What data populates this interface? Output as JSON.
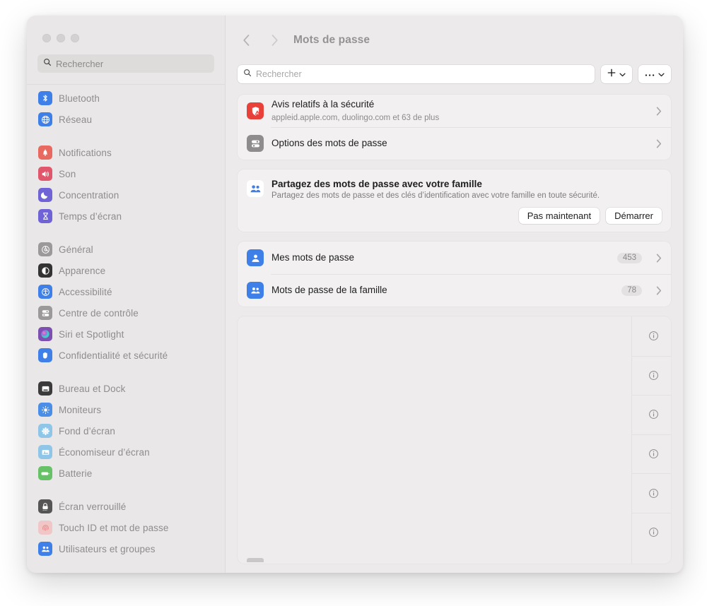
{
  "window": {
    "traffic_lights": [
      "close",
      "minimize",
      "zoom"
    ]
  },
  "sidebar": {
    "search": {
      "placeholder": "Rechercher",
      "value": "",
      "icon": "search-icon"
    },
    "groups": [
      {
        "items": [
          {
            "label": "Bluetooth",
            "icon": "bluetooth-icon",
            "color": "#3f7fe8"
          },
          {
            "label": "Réseau",
            "icon": "globe-icon",
            "color": "#3f7fe8"
          }
        ]
      },
      {
        "items": [
          {
            "label": "Notifications",
            "icon": "bell-icon",
            "color": "#e8695f"
          },
          {
            "label": "Son",
            "icon": "speaker-icon",
            "color": "#e0566a"
          },
          {
            "label": "Concentration",
            "icon": "moon-icon",
            "color": "#6f63d6"
          },
          {
            "label": "Temps d’écran",
            "icon": "hourglass-icon",
            "color": "#6f63d6"
          }
        ]
      },
      {
        "items": [
          {
            "label": "Général",
            "icon": "gear-icon",
            "color": "#9b9999"
          },
          {
            "label": "Apparence",
            "icon": "contrast-icon",
            "color": "#333333"
          },
          {
            "label": "Accessibilité",
            "icon": "accessibility-icon",
            "color": "#3f7fe8"
          },
          {
            "label": "Centre de contrôle",
            "icon": "control-center-icon",
            "color": "#9b9999"
          },
          {
            "label": "Siri et Spotlight",
            "icon": "siri-icon",
            "color": "#7d4fb0"
          },
          {
            "label": "Confidentialité et sécurité",
            "icon": "hand-icon",
            "color": "#3f7fe8"
          }
        ]
      },
      {
        "items": [
          {
            "label": "Bureau et Dock",
            "icon": "desktop-dock-icon",
            "color": "#3b3b3b"
          },
          {
            "label": "Moniteurs",
            "icon": "brightness-icon",
            "color": "#4b8ee8"
          },
          {
            "label": "Fond d’écran",
            "icon": "wallpaper-icon",
            "color": "#8fc6e8"
          },
          {
            "label": "Économiseur d’écran",
            "icon": "screensaver-icon",
            "color": "#8fc6e8"
          },
          {
            "label": "Batterie",
            "icon": "battery-icon",
            "color": "#67c267"
          }
        ]
      },
      {
        "items": [
          {
            "label": "Écran verrouillé",
            "icon": "lock-screen-icon",
            "color": "#555555"
          },
          {
            "label": "Touch ID et mot de passe",
            "icon": "fingerprint-icon",
            "color": "#f0c6c6"
          },
          {
            "label": "Utilisateurs et groupes",
            "icon": "users-groups-icon",
            "color": "#3f7fe8"
          }
        ]
      }
    ]
  },
  "detail": {
    "nav": {
      "back_icon": "chevron-left-icon",
      "forward_icon": "chevron-right-icon"
    },
    "title": "Mots de passe",
    "toolbar": {
      "search_placeholder": "Rechercher",
      "search_value": "",
      "add_label": "+",
      "more_label": "•••"
    },
    "security_card": {
      "rows": [
        {
          "title": "Avis relatifs à la sécurité",
          "subtitle": "appleid.apple.com, duolingo.com et 63 de plus",
          "icon": "security-shield-warning-icon",
          "color": "#e8413a",
          "chevron": "chevron-right-icon"
        },
        {
          "title": "Options des mots de passe",
          "subtitle": "",
          "icon": "password-options-icon",
          "color": "#8e8c8c",
          "chevron": "chevron-right-icon"
        }
      ]
    },
    "share_card": {
      "icon": "family-share-icon",
      "color": "#ffffff",
      "title": "Partagez des mots de passe avec votre famille",
      "subtitle": "Partagez des mots de passe et des clés d’identification avec votre famille en toute sécurité.",
      "dismiss_label": "Pas maintenant",
      "start_label": "Démarrer"
    },
    "password_lists": [
      {
        "title": "Mes mots de passe",
        "count": "453",
        "icon": "person-icon",
        "color": "#3f7fe8",
        "chevron": "chevron-right-icon"
      },
      {
        "title": "Mots de passe de la famille",
        "count": "78",
        "icon": "people-icon",
        "color": "#3f7fe8",
        "chevron": "chevron-right-icon"
      }
    ],
    "entry_list": {
      "rows": [
        {
          "info_icon": "info-circle-icon"
        },
        {
          "info_icon": "info-circle-icon"
        },
        {
          "info_icon": "info-circle-icon"
        },
        {
          "info_icon": "info-circle-icon"
        },
        {
          "info_icon": "info-circle-icon"
        },
        {
          "info_icon": "info-circle-icon"
        }
      ]
    }
  }
}
